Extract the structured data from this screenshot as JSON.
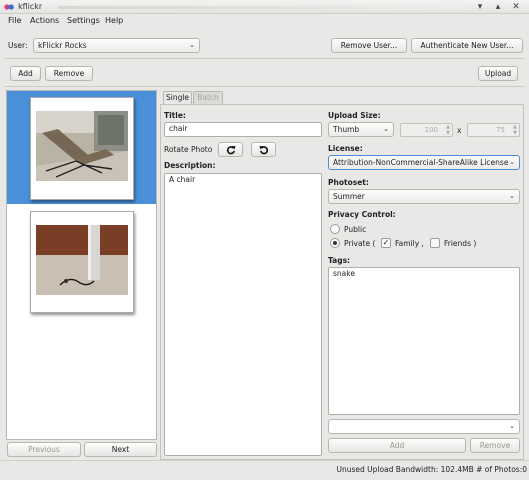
{
  "window": {
    "title": "kflickr",
    "icon": "kflickr-app-icon",
    "controls": [
      "minimize-icon",
      "maximize-icon",
      "close-icon"
    ]
  },
  "menu": {
    "items": [
      "File",
      "Actions",
      "Settings",
      "Help"
    ]
  },
  "user_row": {
    "label": "User:",
    "selected_user": "kFlickr Rocks",
    "remove_user": "Remove User...",
    "authenticate": "Authenticate New User..."
  },
  "toolbar": {
    "add": "Add",
    "remove": "Remove",
    "upload": "Upload"
  },
  "photo_list": {
    "photos": [
      {
        "subject": "folding-chair-photo",
        "selected": true
      },
      {
        "subject": "floor-with-pillar-photo",
        "selected": false
      }
    ],
    "previous": "Previous",
    "next": "Next"
  },
  "tabs": [
    "Single",
    "Batch"
  ],
  "form": {
    "title_label": "Title:",
    "title_value": "chair",
    "rotate_label": "Rotate Photo",
    "description_label": "Description:",
    "description_value": "A chair",
    "upload_size_label": "Upload Size:",
    "upload_size_value": "Thumb",
    "width_value": "100",
    "times": "x",
    "height_value": "75",
    "license_label": "License:",
    "license_value": "Attribution-NonCommercial-ShareAlike License",
    "photoset_label": "Photoset:",
    "photoset_value": "Summer",
    "privacy_label": "Privacy Control:",
    "public_label": "Public",
    "private_label": "Private (",
    "family_label": "Family ,",
    "friends_label": "Friends )",
    "tags_label": "Tags:",
    "tags_value": "snake",
    "tag_add": "Add",
    "tag_remove": "Remove"
  },
  "status": {
    "text": "Unused Upload Bandwidth: 102.4MB  # of Photos:0"
  },
  "colors": {
    "selection": "#4a90d9",
    "window_bg": "#e9e8e6",
    "app_icon_pink": "#e0387a",
    "app_icon_blue": "#2f6fd6"
  }
}
